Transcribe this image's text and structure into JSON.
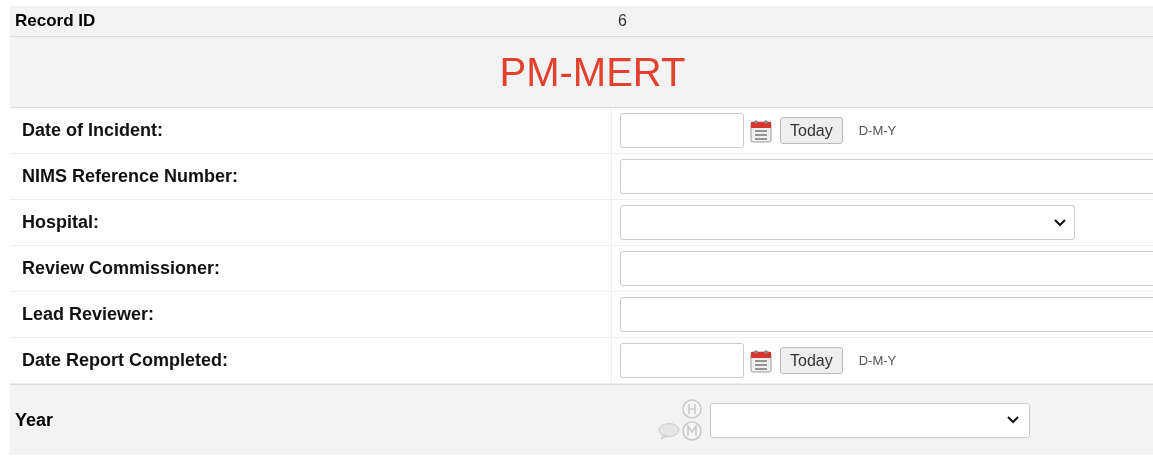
{
  "record_id": {
    "label": "Record ID",
    "value": "6"
  },
  "title": "PM-MERT",
  "fields": [
    {
      "label": "Date of Incident:",
      "kind": "date",
      "button": "Today",
      "format": "D-M-Y"
    },
    {
      "label": "NIMS Reference Number:",
      "kind": "text"
    },
    {
      "label": "Hospital:",
      "kind": "select"
    },
    {
      "label": "Review Commissioner:",
      "kind": "text"
    },
    {
      "label": "Lead Reviewer:",
      "kind": "text"
    },
    {
      "label": "Date Report Completed:",
      "kind": "date",
      "button": "Today",
      "format": "D-M-Y"
    }
  ],
  "year": {
    "label": "Year"
  }
}
